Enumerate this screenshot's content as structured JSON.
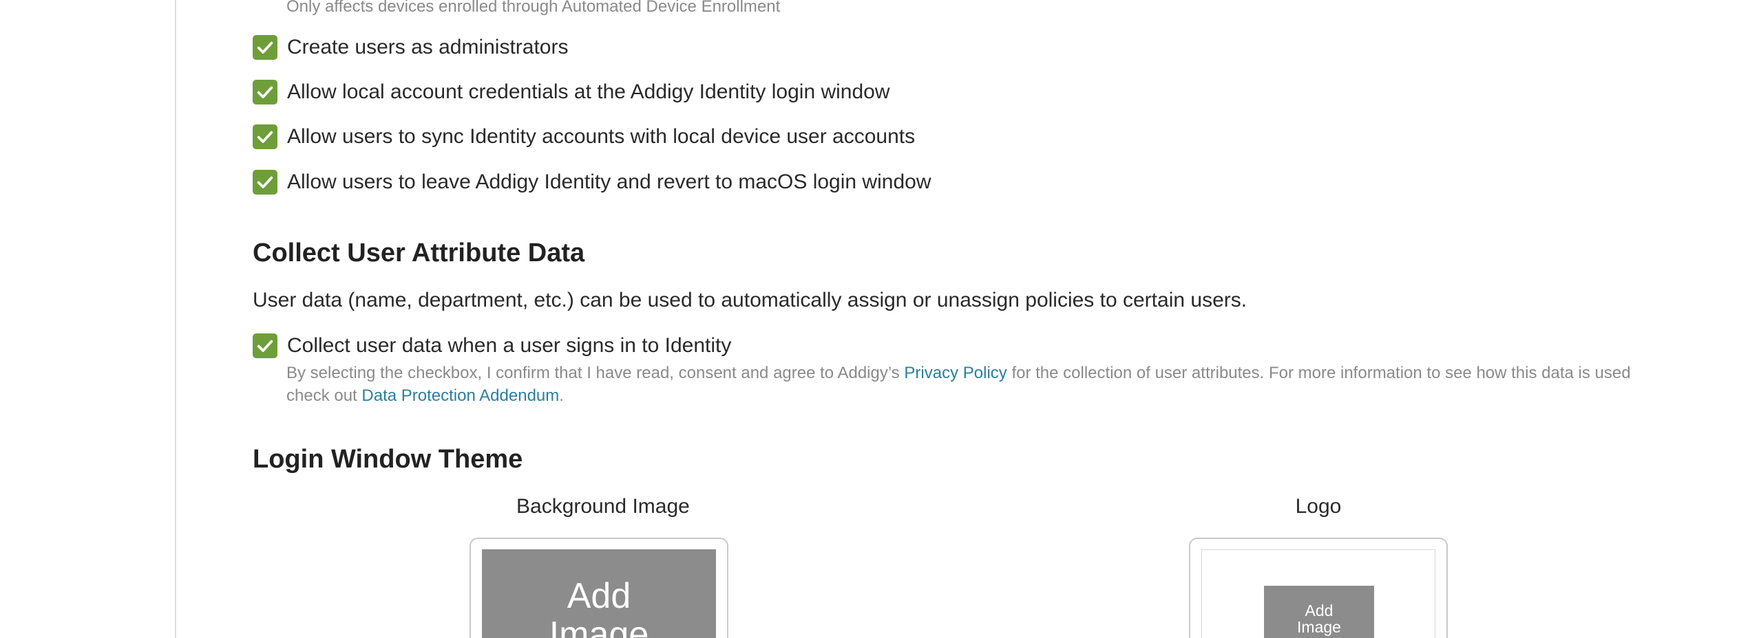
{
  "top_hint": "Only affects devices enrolled through Automated Device Enrollment",
  "options": [
    {
      "label": "Create users as administrators",
      "checked": true
    },
    {
      "label": "Allow local account credentials at the Addigy Identity login window",
      "checked": true
    },
    {
      "label": "Allow users to sync Identity accounts with local device user accounts",
      "checked": true
    },
    {
      "label": "Allow users to leave Addigy Identity and revert to macOS login window",
      "checked": true
    }
  ],
  "collect_section": {
    "title": "Collect User Attribute Data",
    "description": "User data (name, department, etc.) can be used to automatically assign or unassign policies to certain users.",
    "checkbox_label": "Collect user data when a user signs in to Identity",
    "checked": true,
    "consent_prefix": "By selecting the checkbox, I confirm that I have read, consent and agree to Addigy’s ",
    "privacy_link": "Privacy Policy",
    "consent_middle": " for the collection of user attributes. For more information to see how this data is used check out ",
    "dpa_link": "Data Protection Addendum",
    "consent_suffix": "."
  },
  "theme_section": {
    "title": "Login Window Theme",
    "background_label": "Background Image",
    "background_placeholder_line1": "Add",
    "background_placeholder_line2": "Image",
    "logo_label": "Logo",
    "logo_placeholder_line1": "Add",
    "logo_placeholder_line2": "Image"
  },
  "colors": {
    "checkbox": "#6e9e3a",
    "link": "#2a7fa0",
    "muted_text": "#8a8a8a",
    "placeholder": "#8c8c8c"
  }
}
